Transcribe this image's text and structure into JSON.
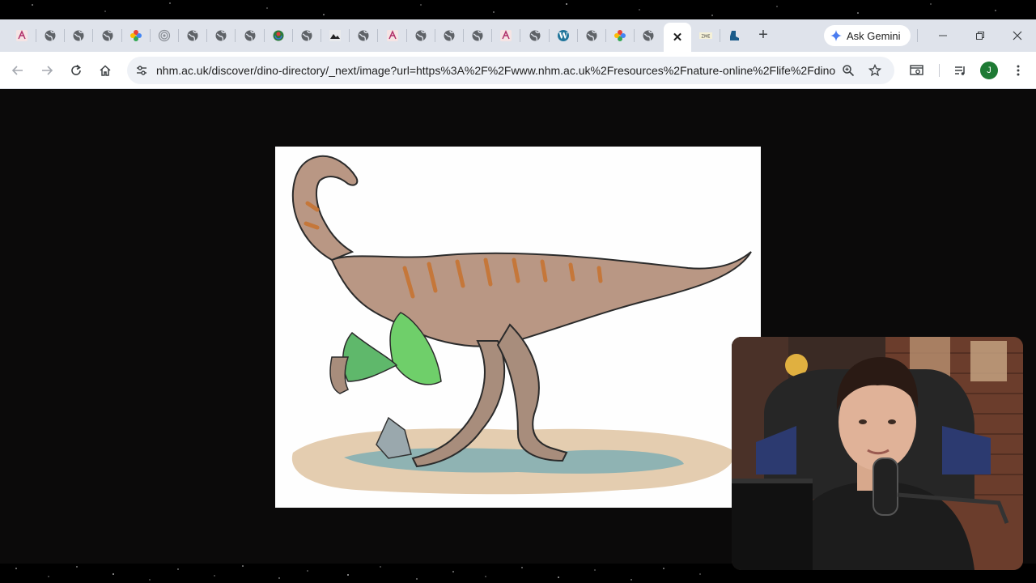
{
  "browser": {
    "tabs": [
      {
        "icon": "sketchfab-icon"
      },
      {
        "icon": "globe-icon"
      },
      {
        "icon": "globe-icon"
      },
      {
        "icon": "globe-icon"
      },
      {
        "icon": "pinwheel-icon"
      },
      {
        "icon": "target-icon"
      },
      {
        "icon": "globe-icon"
      },
      {
        "icon": "globe-icon"
      },
      {
        "icon": "globe-icon"
      },
      {
        "icon": "wikimedia-icon"
      },
      {
        "icon": "globe-icon"
      },
      {
        "icon": "photo-icon"
      },
      {
        "icon": "globe-icon"
      },
      {
        "icon": "sketchfab-icon"
      },
      {
        "icon": "globe-icon"
      },
      {
        "icon": "globe-icon"
      },
      {
        "icon": "globe-icon"
      },
      {
        "icon": "sketchfab-icon"
      },
      {
        "icon": "globe-icon"
      },
      {
        "icon": "wordpress-icon"
      },
      {
        "icon": "globe-icon"
      },
      {
        "icon": "pinwheel-icon"
      },
      {
        "icon": "globe-icon"
      },
      {
        "icon": "close-icon",
        "active": true
      },
      {
        "icon": "zme-icon",
        "label": "ZME"
      },
      {
        "icon": "boot-icon"
      }
    ],
    "new_tab_label": "+",
    "ask_gemini_label": "Ask Gemini",
    "address_bar": {
      "url": "nhm.ac.uk/discover/dino-directory/_next/image?url=https%3A%2F%2Fwww.nhm.ac.uk%2Fresources%2Fnature-online%2Flife%2Fdino..."
    },
    "profile_initial": "J"
  },
  "colors": {
    "tabstrip_bg": "#dfe3eb",
    "toolbar_bg": "#ffffff",
    "omnibox_bg": "#eef1f6",
    "page_bg": "#0b0a0a",
    "avatar_bg": "#1e7a34"
  },
  "content": {
    "image": "dinosaur-illustration",
    "overlay": "webcam-presenter"
  }
}
